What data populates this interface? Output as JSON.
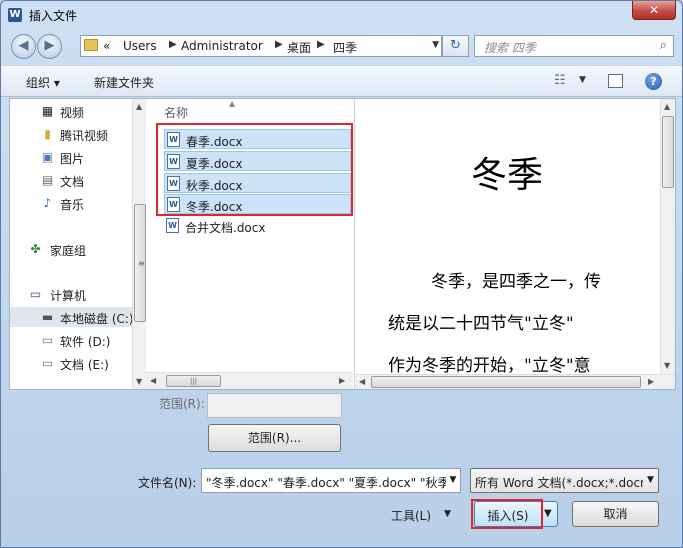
{
  "window": {
    "title": "插入文件",
    "app_icon": "word-icon",
    "close_label": "✕"
  },
  "address": {
    "overflow": "«",
    "crumbs": [
      "Users",
      "Administrator",
      "桌面",
      "四季"
    ]
  },
  "search": {
    "placeholder": "搜索 四季"
  },
  "toolbar": {
    "organize": "组织 ▾",
    "new_folder": "新建文件夹"
  },
  "nav_pane": {
    "items": [
      {
        "label": "视频",
        "icon": "video-icon"
      },
      {
        "label": "腾讯视频",
        "icon": "folder-icon"
      },
      {
        "label": "图片",
        "icon": "picture-icon"
      },
      {
        "label": "文档",
        "icon": "document-icon"
      },
      {
        "label": "音乐",
        "icon": "music-icon"
      },
      {
        "label": "家庭组",
        "icon": "homegroup-icon"
      },
      {
        "label": "计算机",
        "icon": "computer-icon"
      },
      {
        "label": "本地磁盘 (C:)",
        "icon": "local-disk-icon"
      },
      {
        "label": "软件 (D:)",
        "icon": "drive-icon"
      },
      {
        "label": "文档 (E:)",
        "icon": "drive-icon"
      }
    ]
  },
  "file_list": {
    "column_header": "名称",
    "files": [
      {
        "name": "春季.docx",
        "selected": true
      },
      {
        "name": "夏季.docx",
        "selected": true
      },
      {
        "name": "秋季.docx",
        "selected": true
      },
      {
        "name": "冬季.docx",
        "selected": true
      },
      {
        "name": "合并文档.docx",
        "selected": false
      }
    ]
  },
  "preview": {
    "title": "冬季",
    "lines": [
      "冬季，是四季之一，传",
      "统是以二十四节气\"立冬\"",
      "作为冬季的开始，\"立冬\"意"
    ]
  },
  "range": {
    "label": "范围(R):",
    "value": "",
    "button": "范围(R)..."
  },
  "filename": {
    "label": "文件名(N):",
    "value": "\"冬季.docx\" \"春季.docx\" \"夏季.docx\" \"秋季.docx\"",
    "type_value": "所有 Word 文档(*.docx;*.docm;*.dotx;*.dotm;*.doc;*.dot)"
  },
  "buttons": {
    "tools": "工具(L)",
    "insert": "插入(S)",
    "cancel": "取消"
  },
  "colors": {
    "highlight_outline": "#e0252b",
    "selection": "#cce3f8",
    "accent": "#3c7fb1"
  }
}
